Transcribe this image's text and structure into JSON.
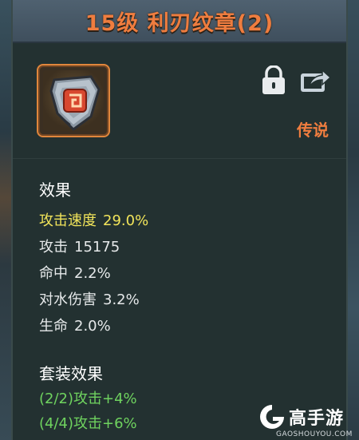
{
  "item": {
    "title": "15级 利刃纹章(2)",
    "rarity": "传说",
    "icon": "blade-emblem-icon"
  },
  "actions": {
    "lock_icon": "lock-icon",
    "share_icon": "share-icon"
  },
  "effects": {
    "heading": "效果",
    "stats": [
      {
        "label": "攻击速度",
        "value": "29.0%"
      },
      {
        "label": "攻击",
        "value": "15175"
      },
      {
        "label": "命中",
        "value": "2.2%"
      },
      {
        "label": "对水伤害",
        "value": "3.2%"
      },
      {
        "label": "生命",
        "value": "2.0%"
      }
    ]
  },
  "set_bonus": {
    "heading": "套装效果",
    "lines": [
      "(2/2)攻击+4%",
      "(4/4)攻击+6%"
    ]
  },
  "watermark": {
    "name": "高手游",
    "url": "GAOSHOUYOU.COM"
  },
  "colors": {
    "title": "#ef7d3f",
    "highlight": "#f1e45a",
    "set_bonus": "#6fd35f",
    "panel": "#233131"
  }
}
